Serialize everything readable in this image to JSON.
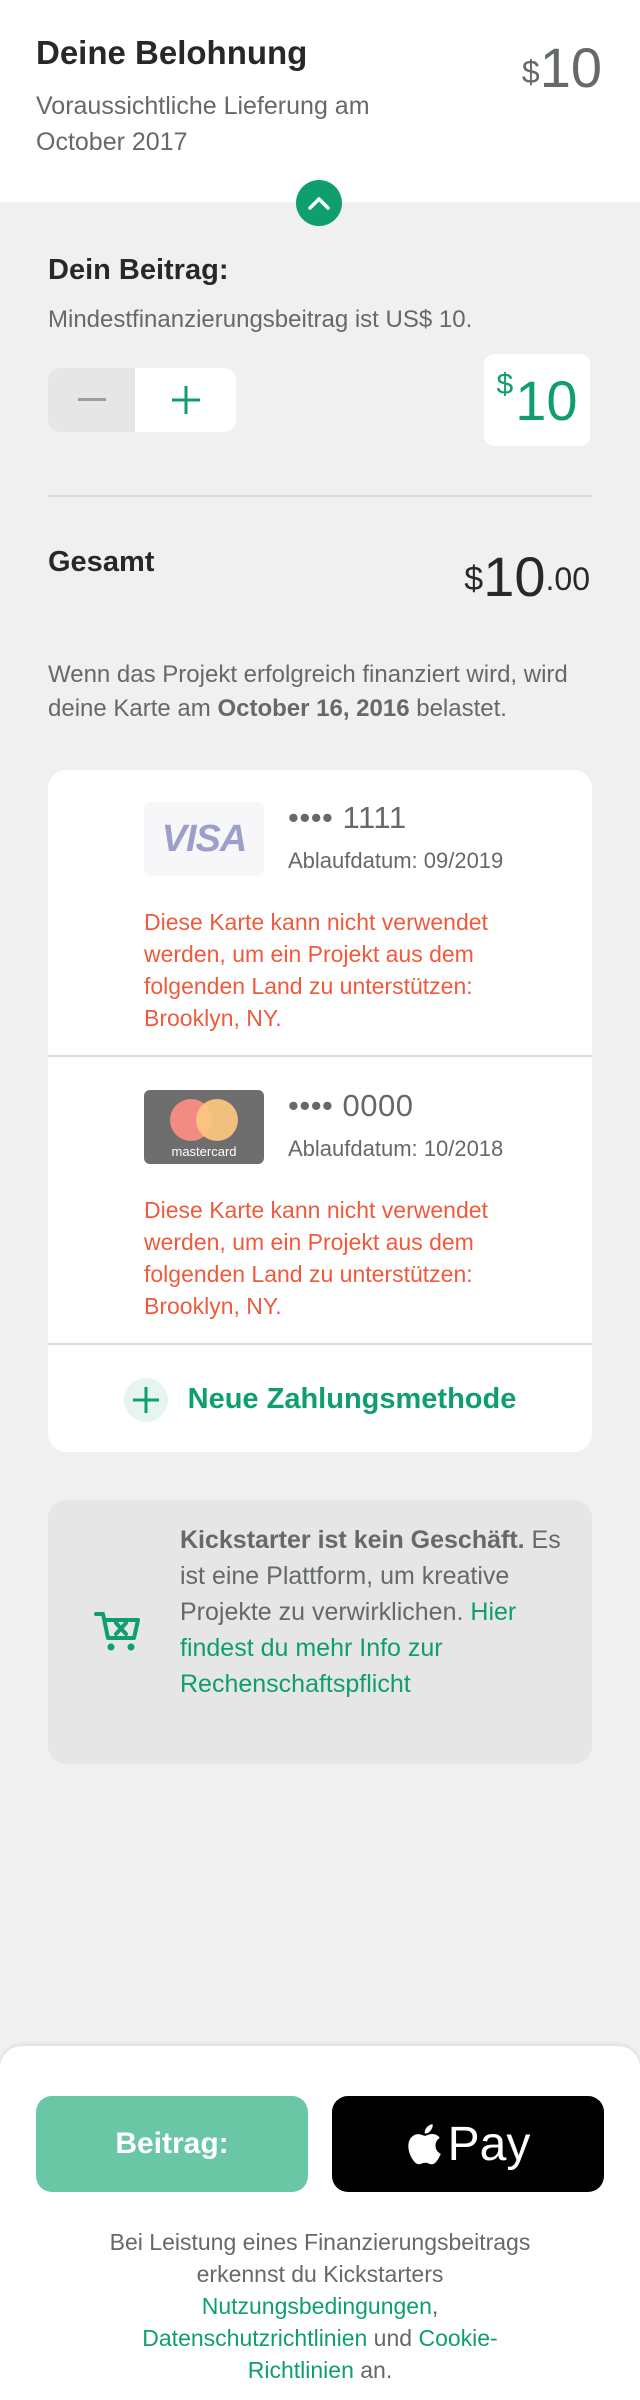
{
  "reward": {
    "title": "Deine Belohnung",
    "delivery": "Voraussichtliche Lieferung am October 2017",
    "currency": "$",
    "amount": "10"
  },
  "pledge": {
    "label": "Dein Beitrag:",
    "minimum": "Mindestfinanzierungsbeitrag ist US$ 10.",
    "currency": "$",
    "amount": "10",
    "minus_icon": "minus-icon",
    "plus_icon": "plus-icon"
  },
  "total": {
    "label": "Gesamt",
    "currency": "$",
    "amount": "10",
    "cents": ".00"
  },
  "charge_note": {
    "before": "Wenn das Projekt erfolgreich finanziert wird, wird deine Karte am ",
    "date": "October 16, 2016",
    "after": " belastet."
  },
  "cards": [
    {
      "brand": "VISA",
      "number": "•••• 1111",
      "expiry": "Ablaufdatum: 09/2019",
      "error": "Diese Karte kann nicht verwendet werden, um ein Projekt aus dem folgenden Land zu unterstützen: Brooklyn, NY."
    },
    {
      "brand": "mastercard",
      "number": "•••• 0000",
      "expiry": "Ablaufdatum: 10/2018",
      "error": "Diese Karte kann nicht verwendet werden, um ein Projekt aus dem folgenden Land zu unterstützen: Brooklyn, NY."
    }
  ],
  "add_method": {
    "label": "Neue Zahlungsmethode"
  },
  "info": {
    "bold": "Kickstarter ist kein Geschäft.",
    "text": " Es ist eine Plattform, um kreative Projekte zu verwirklichen. ",
    "link": "Hier findest du mehr Info zur Rechenschaftspflicht"
  },
  "footer": {
    "pledge_button": "Beitrag:",
    "apple_pay_label": "Pay",
    "legal_1": "Bei Leistung eines Finanzierungsbeitrags erkennst du Kickstarters ",
    "terms_link": "Nutzungsbedingungen",
    "legal_2": ", ",
    "privacy_link": "Datenschutzrichtlinien",
    "legal_3": " und ",
    "cookie_link": "Cookie-Richtlinien",
    "legal_4": " an."
  },
  "colors": {
    "accent": "#0f9e6e",
    "error": "#f05a3c",
    "pledge_button": "#69c7a6"
  }
}
